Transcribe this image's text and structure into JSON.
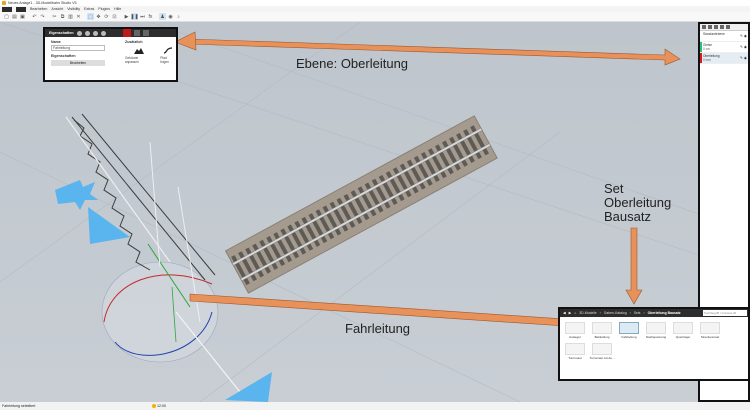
{
  "window": {
    "title": "Neues Anlage1 - 3D-Modellbahn Studio V5"
  },
  "menu": [
    "Bearbeiten",
    "Ansicht",
    "Visibility",
    "Extras",
    "Plugins",
    "Hilfe"
  ],
  "toolbar": {
    "icons": [
      "new-file-icon",
      "open-icon",
      "save-icon",
      "undo-icon",
      "redo-icon",
      "cut-icon",
      "copy-icon",
      "paste-icon",
      "delete-icon",
      "select-icon",
      "move-icon",
      "rotate-icon",
      "zoom-fit-icon",
      "play-icon",
      "pause-icon",
      "step-icon",
      "person-icon",
      "camera-icon",
      "sound-icon"
    ],
    "play_label": "▶",
    "pause_label": "❚❚",
    "fx_label": "fx"
  },
  "properties": {
    "title": "Eigenschaften",
    "name_label": "Name",
    "name_value": "Fahrleitung",
    "section_label": "Eigenschaften",
    "edit_button": "Bearbeiten",
    "extra_label": "Zusätzlich",
    "option_1": "Gebäude anpassen",
    "option_2": "Pfad folgen"
  },
  "layers": {
    "rows": [
      {
        "name": "Standardebene",
        "sub": "",
        "color": "#ffffff"
      },
      {
        "name": "Gleise",
        "sub": "0 cm",
        "color": "#27c27a"
      },
      {
        "name": "Oberleitung",
        "sub": "0 mm",
        "color": "#d71b1b",
        "selected": true
      }
    ]
  },
  "catalog": {
    "breadcrumb": [
      "3D-Modelle",
      "Gaben-Katalog",
      "Sets",
      "Oberleitung Bausatz"
    ],
    "search_placeholder": "Suchbegriff / Content-ID",
    "items": [
      "Ausleger",
      "Bekleidung",
      "Fahrleitung",
      "Nachspannung",
      "Querträger",
      "Streckenmast",
      "Turmmast",
      "Turmmast mit Au..."
    ]
  },
  "status": {
    "message": "Fahrleitung selektiert",
    "time": "12:00"
  },
  "annotations": {
    "ebene": "Ebene: Oberleitung",
    "set": "Set\nOberleitung\nBausatz",
    "fahrleitung": "Fahrleitung"
  },
  "colors": {
    "arrow": "#e8915a",
    "arrow_stroke": "#9a5a30",
    "selection_blue": "#5ab4ee",
    "layer_red": "#d71b1b",
    "layer_green": "#27c27a"
  }
}
